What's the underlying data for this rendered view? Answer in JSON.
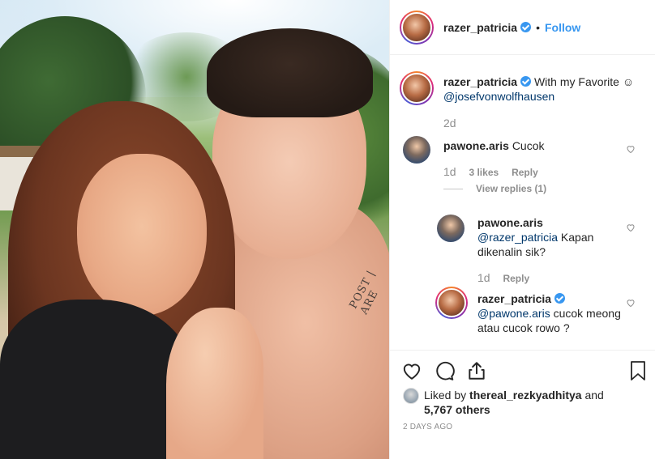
{
  "post": {
    "author": "razer_patricia",
    "follow_label": "Follow",
    "separator": "•",
    "tattoo_text": "POST | ARE"
  },
  "comments": [
    {
      "username": "razer_patricia",
      "text": "With my Favorite ☺",
      "mention": "@josefvonwolfhausen",
      "time": "2d",
      "verified": true
    },
    {
      "username": "pawone.aris",
      "text": "Cucok",
      "time": "1d",
      "likes": "3 likes",
      "reply_label": "Reply",
      "view_replies": "View replies (1)"
    },
    {
      "username": "pawone.aris",
      "mention": "@razer_patricia",
      "text": "Kapan dikenalin sik?",
      "time": "1d",
      "reply_label": "Reply"
    },
    {
      "username": "razer_patricia",
      "mention": "@pawone.aris",
      "text": "cucok meong atau cucok rowo ?",
      "verified": true
    }
  ],
  "likes": {
    "prefix": "Liked by",
    "user": "thereal_rezkyadhitya",
    "suffix": "and",
    "others": "5,767 others"
  },
  "date": "2 DAYS AGO",
  "colors": {
    "link": "#3897f0",
    "mention": "#00376b",
    "muted": "#8e8e8e"
  },
  "icons": [
    "heart-icon",
    "comment-icon",
    "share-icon",
    "bookmark-icon",
    "verified-badge-icon"
  ]
}
